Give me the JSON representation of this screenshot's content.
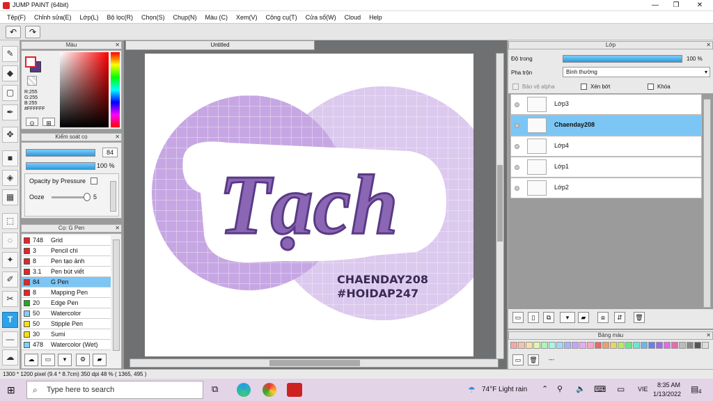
{
  "window": {
    "title": "JUMP PAINT (64bit)",
    "min": "—",
    "max": "❐",
    "close": "✕"
  },
  "menu": [
    "Tệp(F)",
    "Chỉnh sửa(E)",
    "Lớp(L)",
    "Bộ lọc(R)",
    "Chọn(S)",
    "Chụp(N)",
    "Màu (C)",
    "Xem(V)",
    "Công cụ(T)",
    "Cửa sổ(W)",
    "Cloud",
    "Help"
  ],
  "color_panel": {
    "title": "Màu",
    "r": "R:255",
    "g": "G:255",
    "b": "B:255",
    "hex": "#FFFFFF",
    "fg": "#ffffff",
    "bg": "#5b3a86"
  },
  "brush_control": {
    "title": "Kiểm soát cọ",
    "size": "84",
    "opacity": "100 %",
    "opacity_pressure": "Opacity by Pressure",
    "ooze_label": "Ooze",
    "ooze_value": "5"
  },
  "brush_list": {
    "title": "Cọ: G Pen",
    "items": [
      {
        "num": "748",
        "name": "Grid",
        "color": "#e02828"
      },
      {
        "num": "3",
        "name": "Pencil chì",
        "color": "#e02828"
      },
      {
        "num": "8",
        "name": "Pen tạo ảnh",
        "color": "#e02828"
      },
      {
        "num": "3.1",
        "name": "Pen bút viết",
        "color": "#e02828"
      },
      {
        "num": "84",
        "name": "G Pen",
        "color": "#e02828"
      },
      {
        "num": "8",
        "name": "Mapping Pen",
        "color": "#e02828"
      },
      {
        "num": "20",
        "name": "Edge Pen",
        "color": "#22aa22"
      },
      {
        "num": "50",
        "name": "Watercolor",
        "color": "#7fd0f5"
      },
      {
        "num": "50",
        "name": "Stipple Pen",
        "color": "#f0e020"
      },
      {
        "num": "30",
        "name": "Sumi",
        "color": "#f0e020"
      },
      {
        "num": "478",
        "name": "Watercolor (Wet)",
        "color": "#7fd0f5"
      }
    ]
  },
  "document": {
    "tab": "Untitled"
  },
  "artwork": {
    "word": "Tạch",
    "line1": "CHAENDAY208",
    "line2": "#HOIDAP247"
  },
  "layers_panel": {
    "title": "Lớp",
    "opacity_label": "Độ trong",
    "opacity_value": "100 %",
    "blend_label": "Pha trộn",
    "blend_value": "Bình thường",
    "protect_alpha": "Bảo vệ alpha",
    "clipping": "Xén bớt",
    "lock": "Khóa",
    "layers": [
      {
        "name": "Lớp3",
        "selected": false
      },
      {
        "name": "Chaenday208",
        "selected": true
      },
      {
        "name": "Lớp4",
        "selected": false
      },
      {
        "name": "Lớp1",
        "selected": false
      },
      {
        "name": "Lớp2",
        "selected": false
      }
    ]
  },
  "palette": {
    "title": "Bảng màu",
    "extra": "---",
    "colors": [
      "#f7a6a6",
      "#f7c3a6",
      "#f7e0a6",
      "#e0f7a6",
      "#a6f7b8",
      "#a6f7e6",
      "#a6d9f7",
      "#a6b5f7",
      "#c4a6f7",
      "#f0a6f7",
      "#f7a6c9",
      "#e86a6a",
      "#e8a06a",
      "#e8d26a",
      "#b8e86a",
      "#6ae888",
      "#6ae8d0",
      "#6ab8e8",
      "#6a7ee8",
      "#a06ae8",
      "#e06ae8",
      "#e86aa8",
      "#bbbbbb",
      "#888888",
      "#555555",
      "#dddddd"
    ]
  },
  "status": {
    "text": "1300 * 1200 pixel   (9.4 * 8.7cm)   350 dpi   48 %   ( 1365, 495 )"
  },
  "taskbar": {
    "search": "Type here to search",
    "weather": "74°F  Light rain",
    "lang": "VIE",
    "time": "8:35 AM",
    "date": "1/13/2022",
    "notif": "4"
  }
}
